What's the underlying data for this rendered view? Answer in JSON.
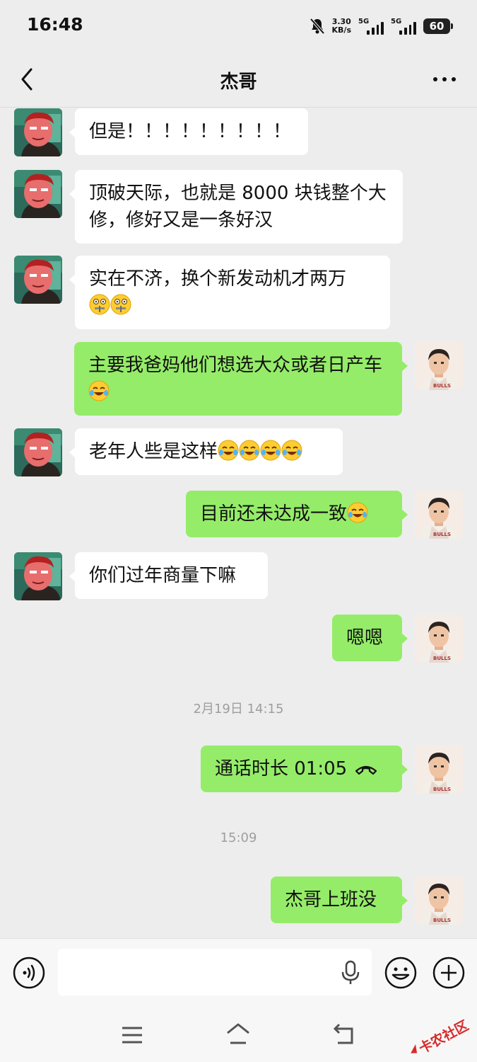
{
  "status_bar": {
    "time": "16:48",
    "net_speed_value": "3.30",
    "net_speed_unit": "KB/s",
    "signal1_label": "5G",
    "signal2_label": "5G",
    "battery": "60",
    "icons": [
      "mute-bell-icon",
      "signal-icon",
      "signal-icon",
      "battery-icon"
    ]
  },
  "header": {
    "title": "杰哥",
    "back_icon": "chevron-left-icon",
    "more_icon": "more-dots-icon"
  },
  "messages": [
    {
      "side": "left",
      "text": "但是！！！！！！！！！"
    },
    {
      "side": "left",
      "text": "顶破天际，也就是 8000 块钱整个大修，修好又是一条好汉"
    },
    {
      "side": "left",
      "text": "实在不济，换个新发动机才两万",
      "emoji": "zipper-mouth-emoji x2"
    },
    {
      "side": "right",
      "text": "主要我爸妈他们想选大众或者日产车",
      "emoji": "crying-laughing-emoji"
    },
    {
      "side": "left",
      "text": "老年人些是这样",
      "emoji": "joy-emoji x4"
    },
    {
      "side": "right",
      "text": "目前还未达成一致",
      "emoji": "crying-laughing-emoji"
    },
    {
      "side": "left",
      "text": "你们过年商量下嘛"
    },
    {
      "side": "right",
      "text": "嗯嗯"
    },
    {
      "type": "timestamp",
      "text": "2月19日 14:15"
    },
    {
      "side": "right",
      "text": "通话时长 01:05",
      "icon": "phone-hangup-icon"
    },
    {
      "type": "timestamp",
      "text": "15:09"
    },
    {
      "side": "right",
      "text": "杰哥上班没"
    }
  ],
  "input_bar": {
    "value": "",
    "placeholder": "",
    "icons": [
      "voice-icon",
      "microphone-icon",
      "emoji-face-icon",
      "plus-circle-icon"
    ]
  },
  "nav_bar": {
    "icons": [
      "menu-icon",
      "home-icon",
      "back-arrow-icon"
    ],
    "watermark": "卡农社区"
  },
  "colors": {
    "background": "#ededed",
    "bubble_left": "#ffffff",
    "bubble_right": "#95ec69",
    "timestamp": "#9e9e9e",
    "watermark": "#d72a2a"
  }
}
